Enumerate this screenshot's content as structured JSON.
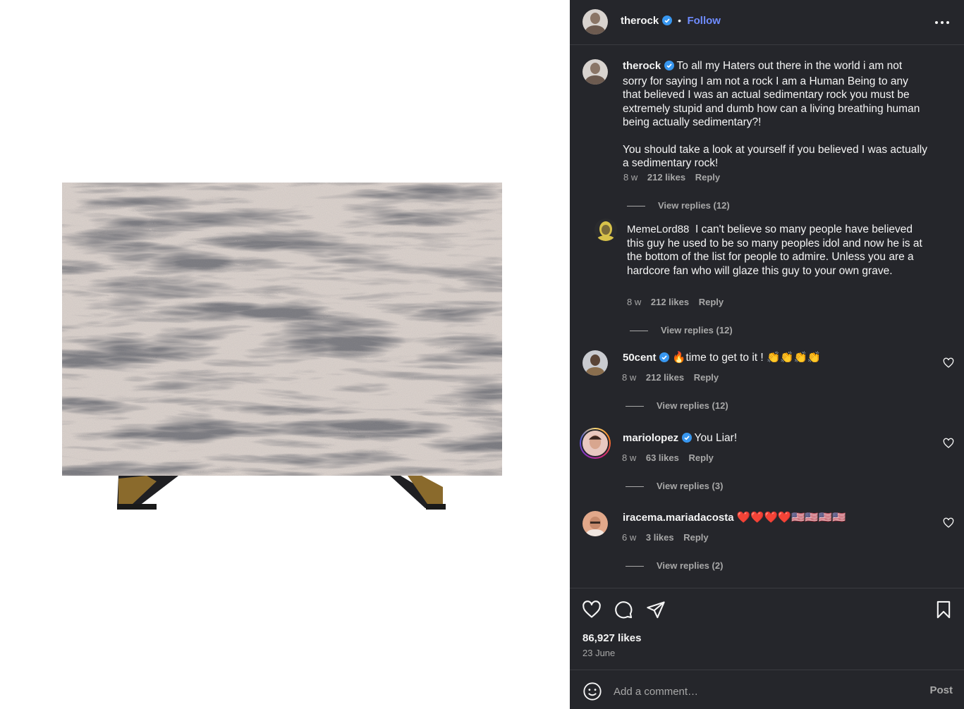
{
  "post": {
    "author": "therock",
    "follow_label": "Follow",
    "separator": "•",
    "likes": "86,927 likes",
    "date": "23 June"
  },
  "caption": {
    "author": "therock",
    "text1": "To all my Haters out there in the world i am not sorry for saying I am not a rock I am a Human Being to any that believed I was an actual sedimentary rock you must be extremely stupid and dumb how can a living breathing human being actually sedimentary?!",
    "text2": "You should take a look at yourself if you believed I was actually a sedimentary rock!",
    "age": "8 w",
    "likes": "212 likes",
    "reply": "Reply",
    "view_replies": "View replies (12)"
  },
  "comments": [
    {
      "author": "MemeLord88",
      "text": "I can't believe so many people have believed this guy he used to be so many peoples idol and now he is at the bottom of the list for people to admire. Unless you are a hardcore fan who will glaze this guy to your own grave.",
      "age": "8 w",
      "likes": "212 likes",
      "reply": "Reply",
      "view_replies": "View replies (12)"
    },
    {
      "author": "50cent",
      "text": "🔥time to get to it ! 👏👏👏👏",
      "age": "8 w",
      "likes": "212 likes",
      "reply": "Reply",
      "view_replies": "View replies (12)"
    },
    {
      "author": "mariolopez",
      "text": "You Liar!",
      "age": "8 w",
      "likes": "63 likes",
      "reply": "Reply",
      "view_replies": "View replies (3)"
    },
    {
      "author": "iracema.mariadacosta",
      "text": "❤️❤️❤️❤️🇺🇸🇺🇸🇺🇸🇺🇸",
      "age": "6 w",
      "likes": "3 likes",
      "reply": "Reply",
      "view_replies": "View replies (2)"
    }
  ],
  "composer": {
    "placeholder": "Add a comment…",
    "post_label": "Post"
  },
  "icons": {
    "more": "more-options-icon",
    "like": "heart-icon",
    "comment": "comment-icon",
    "share": "share-icon",
    "save": "bookmark-icon",
    "emoji": "emoji-icon",
    "verified": "verified-badge-icon"
  },
  "colors": {
    "panel_bg": "#25262b",
    "accent": "#6f8cff",
    "verified": "#3897f0",
    "muted": "#a8a8a8"
  }
}
